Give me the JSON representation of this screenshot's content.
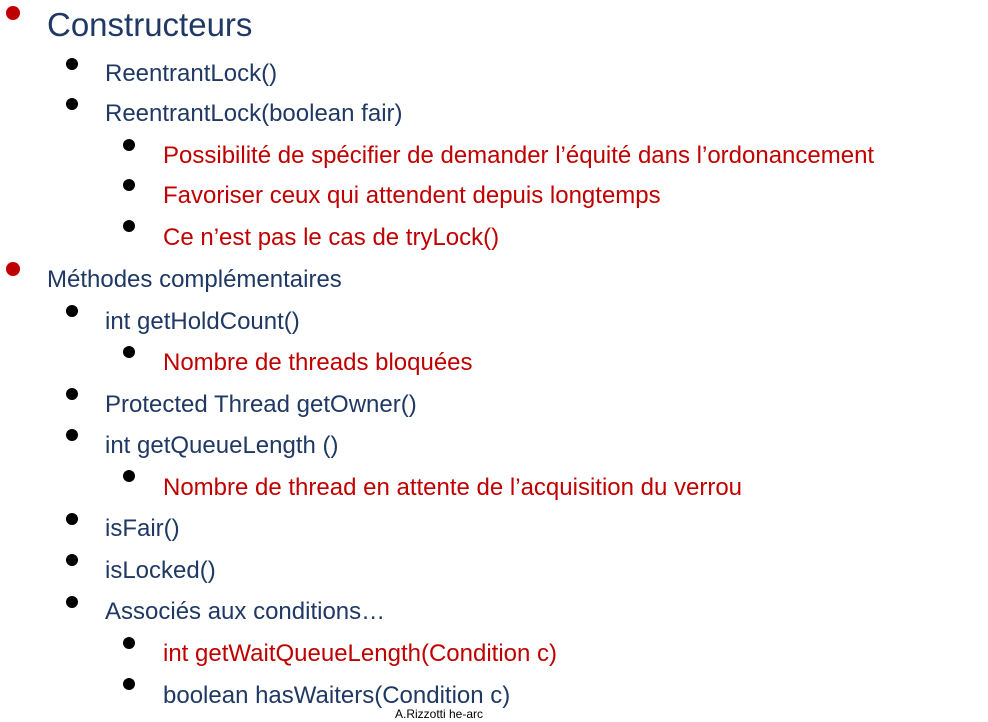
{
  "sections": [
    {
      "heading": "Constructeurs",
      "items": [
        {
          "text": "ReentrantLock()"
        },
        {
          "text": "ReentrantLock(boolean fair)",
          "subitems": [
            "Possibilité de spécifier de demander l’équité dans l’ordonancement",
            "Favoriser ceux qui attendent depuis longtemps",
            "Ce n’est pas le cas de tryLock()"
          ]
        }
      ]
    },
    {
      "heading": "Méthodes complémentaires",
      "items": [
        {
          "text": "int  getHoldCount()",
          "subitems": [
            "Nombre de threads bloquées"
          ]
        },
        {
          "text": "Protected Thread getOwner()"
        },
        {
          "text": "int getQueueLength ()",
          "subitems": [
            "Nombre de thread en attente de l’acquisition du verrou"
          ]
        },
        {
          "text": "isFair()"
        },
        {
          "text": "isLocked()"
        },
        {
          "text": "Associés aux conditions…",
          "subitems": [
            "int getWaitQueueLength(Condition c)",
            "boolean hasWaiters(Condition c)"
          ]
        }
      ]
    }
  ],
  "footer": "A.Rizzotti he-arc",
  "colors": {
    "heading": "#1f3864",
    "subitem": "#c00000",
    "top_bullet": "#c00000",
    "bullet": "#000000"
  }
}
